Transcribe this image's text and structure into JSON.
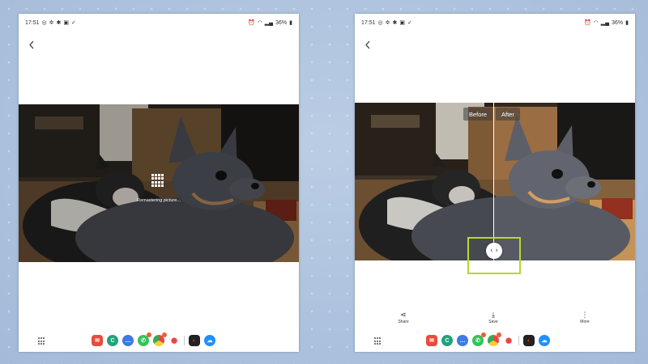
{
  "screens": {
    "left": {
      "status": {
        "time": "17:51",
        "battery": "36%"
      },
      "progress_text": "Remastering picture..."
    },
    "right": {
      "status": {
        "time": "17:51",
        "battery": "36%"
      },
      "compare": {
        "before_label": "Before",
        "after_label": "After",
        "handle_glyph": "‹ ›"
      },
      "actions": [
        {
          "label": "Share",
          "icon": "share-icon"
        },
        {
          "label": "Save",
          "icon": "download-icon"
        },
        {
          "label": "More",
          "icon": "more-vertical-icon"
        }
      ]
    }
  },
  "dock_apps": [
    "mail-icon",
    "phone-icon",
    "messages-icon",
    "whatsapp-icon",
    "chrome-icon",
    "maps-icon",
    "fitness-icon",
    "cloud-icon"
  ],
  "colors": {
    "highlight": "#b6d92b",
    "background": "#aac0dc"
  }
}
